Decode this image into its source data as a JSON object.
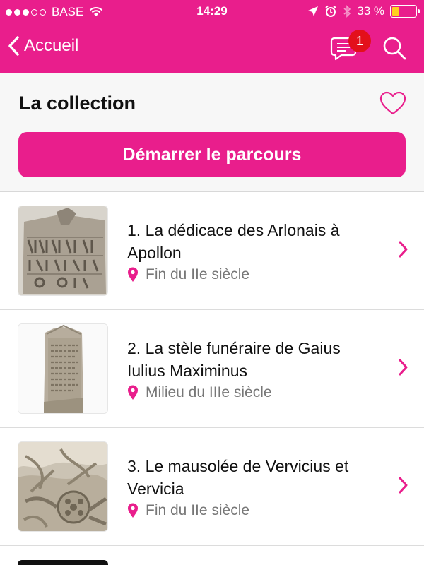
{
  "status_bar": {
    "carrier": "BASE",
    "time": "14:29",
    "battery": "33 %",
    "signal_bars": 3,
    "battery_level": 0.33
  },
  "nav": {
    "back_label": "Accueil",
    "notification_count": "1"
  },
  "header": {
    "title": "La collection",
    "start_button": "Démarrer le parcours"
  },
  "collection": [
    {
      "title": "1. La dédicace des Arlonais à Apollon",
      "period": "Fin du IIe siècle"
    },
    {
      "title": "2. La stèle funéraire de Gaius Iulius Maximinus",
      "period": "Milieu du IIIe siècle"
    },
    {
      "title": "3. Le mausolée de Vervicius et Vervicia",
      "period": "Fin du IIe siècle"
    }
  ],
  "colors": {
    "accent": "#e91e8c",
    "badge": "#e3101b",
    "meta_text": "#777777"
  },
  "icons": [
    "back-chevron-icon",
    "chat-icon",
    "search-icon",
    "heart-icon",
    "location-pin-icon",
    "chevron-right-icon"
  ]
}
